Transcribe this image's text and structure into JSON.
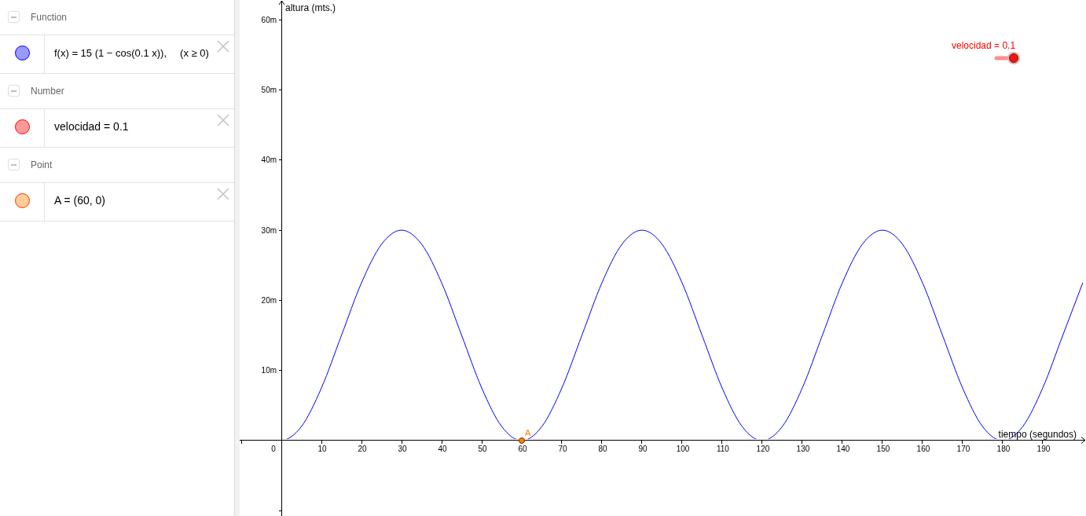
{
  "algebra": {
    "groups": [
      {
        "title": "Function",
        "expanded": true,
        "items": [
          {
            "text": "f(x) = 15 (1 − cos(0.1 x)),",
            "condition": "(x ≥ 0)",
            "color": "#9999ff"
          }
        ]
      },
      {
        "title": "Number",
        "expanded": true,
        "items": [
          {
            "text": "velocidad = 0.1",
            "color": "#ff9999"
          }
        ]
      },
      {
        "title": "Point",
        "expanded": true,
        "items": [
          {
            "text": "A = (60, 0)",
            "color": "#ffcc99"
          }
        ]
      }
    ]
  },
  "graphics": {
    "slider": {
      "label": "velocidad = 0.1",
      "level": 1
    },
    "origin_label": "0",
    "chart_data": {
      "type": "line",
      "xlabel": "tiempo (segundos)",
      "ylabel": "altura (mts.)",
      "x": [
        0,
        5,
        10,
        15,
        20,
        25,
        30,
        35,
        40,
        45,
        50,
        55,
        60,
        65,
        70,
        75,
        80,
        85,
        90,
        95,
        100,
        105,
        110,
        115,
        120,
        125,
        130,
        135,
        140,
        145,
        150,
        155,
        160,
        165,
        170,
        175,
        180,
        185,
        190,
        195,
        200
      ],
      "series": [
        {
          "color": "#0000ff",
          "values": [
            0,
            2,
            7.5,
            15,
            22.5,
            28,
            30,
            28,
            22.5,
            15,
            7.5,
            2,
            0,
            2,
            7.5,
            15,
            22.5,
            28,
            30,
            28,
            22.5,
            15,
            7.5,
            2,
            0,
            2,
            7.5,
            15,
            22.5,
            28,
            30,
            28,
            22.5,
            15,
            7.5,
            2,
            0,
            2,
            7.5,
            15,
            22.5
          ]
        }
      ],
      "xlim": [
        -10.4,
        200.8
      ],
      "ylim": [
        -10.75,
        62.82
      ],
      "xticks": [
        10,
        20,
        30,
        40,
        50,
        60,
        70,
        80,
        90,
        100,
        110,
        120,
        130,
        140,
        150,
        160,
        170,
        180,
        190
      ],
      "yticks": [
        {
          "value": 10,
          "label": "10m"
        },
        {
          "value": 20,
          "label": "20m"
        },
        {
          "value": 30,
          "label": "30m"
        },
        {
          "value": 40,
          "label": "40m"
        },
        {
          "value": 50,
          "label": "50m"
        },
        {
          "value": 60,
          "label": "60m"
        }
      ],
      "annotations": [
        {
          "text": "A",
          "x": 60,
          "y": 0
        }
      ]
    }
  }
}
